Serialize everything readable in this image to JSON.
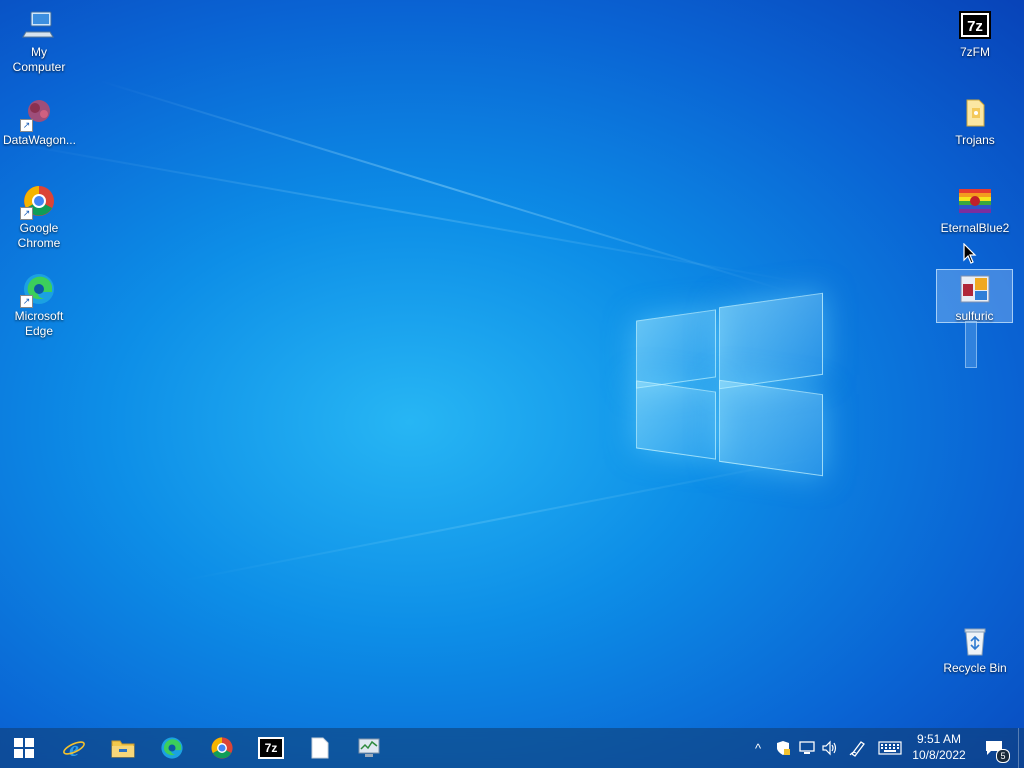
{
  "desktop": {
    "left_icons": [
      {
        "label_line1": "My Computer",
        "label_line2": "",
        "icon": "computer-icon",
        "shortcut": false
      },
      {
        "label_line1": "DataWagon...",
        "label_line2": "",
        "icon": "datawagon-icon",
        "shortcut": true
      },
      {
        "label_line1": "Google",
        "label_line2": "Chrome",
        "icon": "chrome-icon",
        "shortcut": true
      },
      {
        "label_line1": "Microsoft",
        "label_line2": "Edge",
        "icon": "edge-icon",
        "shortcut": true
      }
    ],
    "right_icons": [
      {
        "label": "7zFM",
        "icon": "7zip-icon"
      },
      {
        "label": "Trojans",
        "icon": "folder-icon"
      },
      {
        "label": "EternalBlue2",
        "icon": "rainbow-flag-icon"
      },
      {
        "label": "sulfuric",
        "icon": "sulfuric-app-icon",
        "selected": true
      },
      {
        "label": "Recycle Bin",
        "icon": "recycle-bin-icon"
      }
    ],
    "shortcut_arrow": "↗"
  },
  "taskbar": {
    "pinned": [
      "start-icon",
      "internet-explorer-icon",
      "file-explorer-icon",
      "edge-icon",
      "chrome-icon",
      "7zip-icon",
      "blank-document-icon",
      "resource-monitor-icon"
    ],
    "seven_zip_label": "7z",
    "tray": {
      "chevron": "^",
      "icons": [
        "security-shield-icon",
        "network-icon",
        "volume-icon",
        "pen-icon",
        "keyboard-icon"
      ],
      "time": "9:51 AM",
      "date": "10/8/2022",
      "notification_count": "5"
    }
  },
  "colors": {
    "accent": "#0a78d7",
    "taskbar": "#1a4a7a"
  }
}
